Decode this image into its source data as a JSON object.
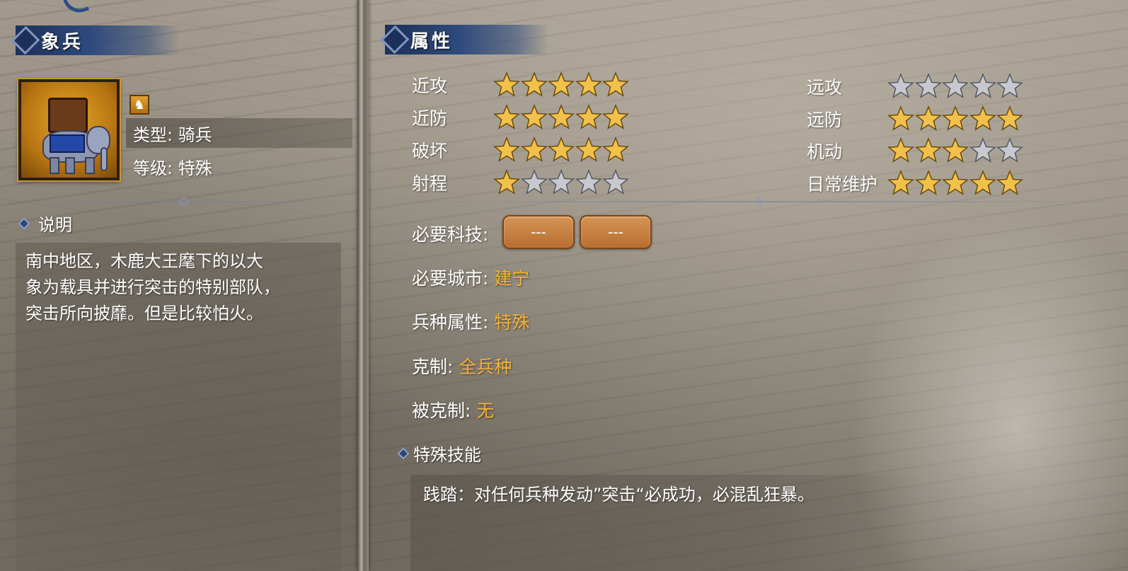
{
  "unit": {
    "name": "象兵",
    "type_line": "类型: 骑兵",
    "level_line": "等级: 特殊",
    "type_icon": "horse-icon"
  },
  "description": {
    "header": "说明",
    "lines": [
      "南中地区，木鹿大王麾下的以大",
      "象为载具并进行突击的特别部队，",
      "突击所向披靡。但是比较怕火。"
    ]
  },
  "attributes": {
    "header": "属性",
    "left": [
      {
        "label": "近攻",
        "stars": 5
      },
      {
        "label": "近防",
        "stars": 5
      },
      {
        "label": "破坏",
        "stars": 5
      },
      {
        "label": "射程",
        "stars": 1
      }
    ],
    "right": [
      {
        "label": "远攻",
        "stars": 0
      },
      {
        "label": "远防",
        "stars": 5
      },
      {
        "label": "机动",
        "stars": 3
      },
      {
        "label": "日常维护",
        "stars": 5
      }
    ],
    "max_stars": 5
  },
  "requirements": {
    "tech_label": "必要科技:",
    "tech_buttons": [
      "---",
      "---"
    ],
    "city_label": "必要城市:",
    "city_value": "建宁",
    "attr_label": "兵种属性:",
    "attr_value": "特殊",
    "counter_label": "克制:",
    "counter_value": "全兵种",
    "countered_label": "被克制:",
    "countered_value": "无"
  },
  "skill": {
    "header": "特殊技能",
    "text": "践踏：对任何兵种发动”突击“必成功，必混乱狂暴。"
  },
  "colors": {
    "header_blue": "#2e4a7c",
    "value_gold": "#f3b23a",
    "star_on": "#f2c14a",
    "star_off": "#c7c9cf",
    "button_orange": "#c67f40"
  }
}
